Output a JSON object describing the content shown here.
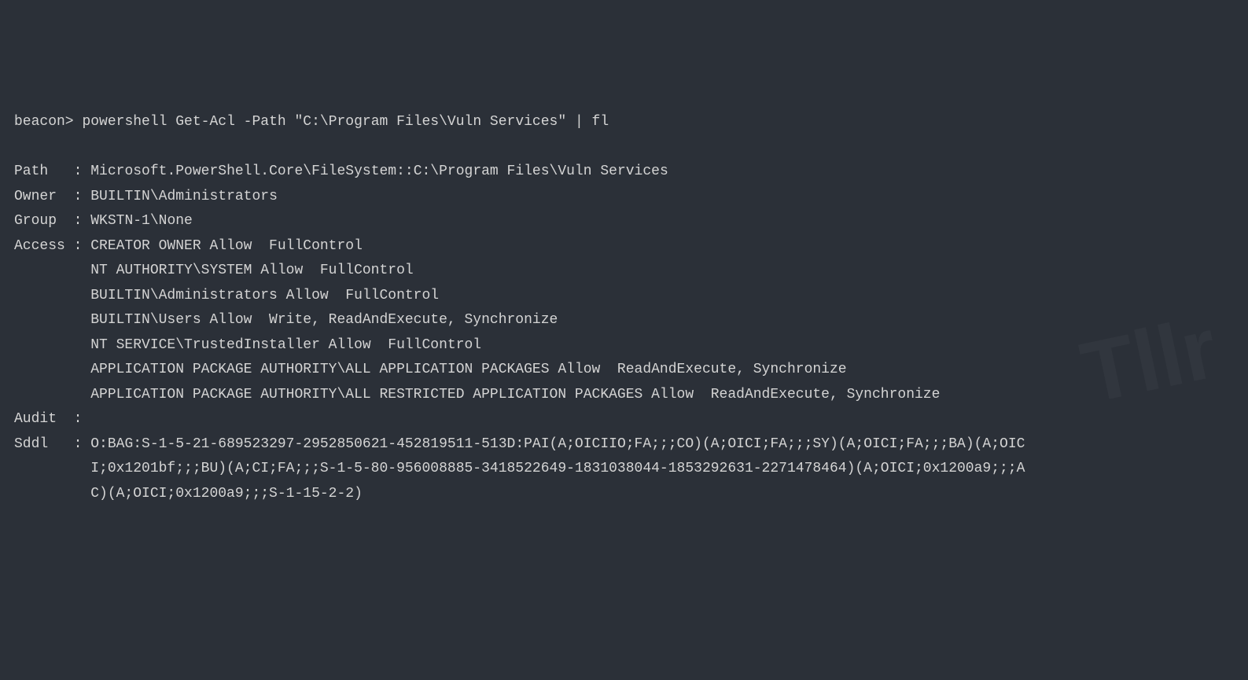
{
  "prompt": "beacon>",
  "command": "powershell Get-Acl -Path \"C:\\Program Files\\Vuln Services\" | fl",
  "output": {
    "path_label": "Path",
    "path_value": "Microsoft.PowerShell.Core\\FileSystem::C:\\Program Files\\Vuln Services",
    "owner_label": "Owner",
    "owner_value": "BUILTIN\\Administrators",
    "group_label": "Group",
    "group_value": "WKSTN-1\\None",
    "access_label": "Access",
    "access_lines": [
      "CREATOR OWNER Allow  FullControl",
      "NT AUTHORITY\\SYSTEM Allow  FullControl",
      "BUILTIN\\Administrators Allow  FullControl",
      "BUILTIN\\Users Allow  Write, ReadAndExecute, Synchronize",
      "NT SERVICE\\TrustedInstaller Allow  FullControl",
      "APPLICATION PACKAGE AUTHORITY\\ALL APPLICATION PACKAGES Allow  ReadAndExecute, Synchronize",
      "APPLICATION PACKAGE AUTHORITY\\ALL RESTRICTED APPLICATION PACKAGES Allow  ReadAndExecute, Synchronize"
    ],
    "audit_label": "Audit",
    "audit_value": "",
    "sddl_label": "Sddl",
    "sddl_lines": [
      "O:BAG:S-1-5-21-689523297-2952850621-452819511-513D:PAI(A;OICIIO;FA;;;CO)(A;OICI;FA;;;SY)(A;OICI;FA;;;BA)(A;OIC",
      "I;0x1201bf;;;BU)(A;CI;FA;;;S-1-5-80-956008885-3418522649-1831038044-1853292631-2271478464)(A;OICI;0x1200a9;;;A",
      "C)(A;OICI;0x1200a9;;;S-1-15-2-2)"
    ]
  },
  "watermark": "Tllr"
}
